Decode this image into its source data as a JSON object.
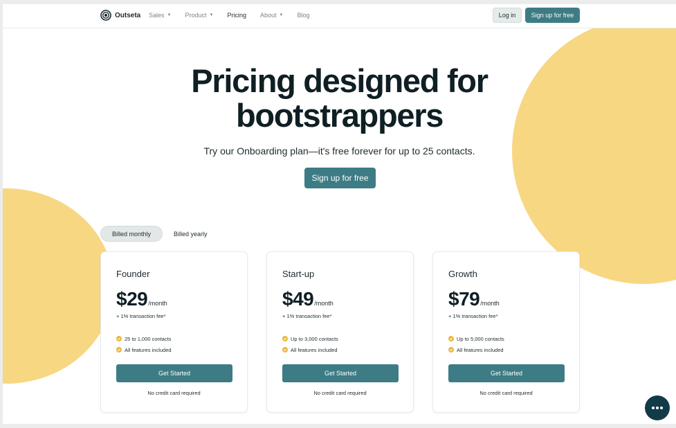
{
  "nav": {
    "logo_text": "Outseta",
    "links": [
      {
        "label": "Sales",
        "dropdown": true
      },
      {
        "label": "Product",
        "dropdown": true
      },
      {
        "label": "Pricing",
        "dropdown": false,
        "active": true
      },
      {
        "label": "About",
        "dropdown": true
      },
      {
        "label": "Blog",
        "dropdown": false
      }
    ],
    "login_label": "Log in",
    "signup_label": "Sign up for free"
  },
  "hero": {
    "title_line1": "Pricing designed for",
    "title_line2": "bootstrappers",
    "subtitle": "Try our Onboarding plan—it's free forever for up to 25 contacts.",
    "cta_label": "Sign up for free"
  },
  "billing": {
    "options": [
      "Billed monthly",
      "Billed yearly"
    ],
    "selected": "Billed monthly"
  },
  "plans": [
    {
      "name": "Founder",
      "price": "$29",
      "period": "/month",
      "fee": "+ 1% transaction fee*",
      "features": [
        "25 to 1,000 contacts",
        "All features included"
      ],
      "cta": "Get Started",
      "note": "No credit card required"
    },
    {
      "name": "Start-up",
      "price": "$49",
      "period": "/month",
      "fee": "+ 1% transaction fee*",
      "features": [
        "Up to 3,000 contacts",
        "All features included"
      ],
      "cta": "Get Started",
      "note": "No credit card required"
    },
    {
      "name": "Growth",
      "price": "$79",
      "period": "/month",
      "fee": "+ 1% transaction fee*",
      "features": [
        "Up to 5,000 contacts",
        "All features included"
      ],
      "cta": "Get Started",
      "note": "No credit card required"
    }
  ],
  "icons": {
    "caret": "chevron-down-icon",
    "check": "check-badge-icon",
    "chat": "chat-bubble-icon"
  },
  "colors": {
    "accent": "#3d7c85",
    "blob": "#f8d783",
    "check": "#e9b73a",
    "chat": "#123b48"
  }
}
